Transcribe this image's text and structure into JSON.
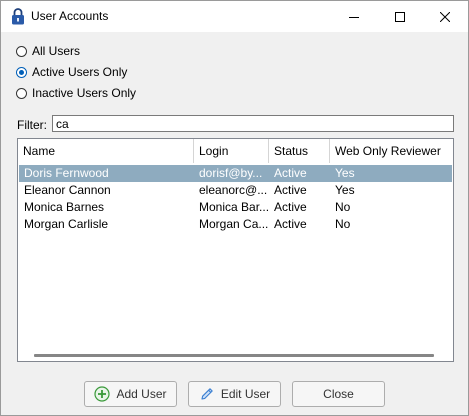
{
  "window": {
    "title": "User Accounts",
    "app_icon": "padlock-icon"
  },
  "filter_options": [
    {
      "label": "All Users",
      "checked": false
    },
    {
      "label": "Active Users Only",
      "checked": true
    },
    {
      "label": "Inactive Users Only",
      "checked": false
    }
  ],
  "filter": {
    "label": "Filter:",
    "value": "ca"
  },
  "table": {
    "columns": [
      "Name",
      "Login",
      "Status",
      "Web Only Reviewer"
    ],
    "rows": [
      {
        "name": "Doris Fernwood",
        "login": "dorisf@by...",
        "status": "Active",
        "web_only_reviewer": "Yes",
        "selected": true
      },
      {
        "name": "Eleanor Cannon",
        "login": "eleanorc@...",
        "status": "Active",
        "web_only_reviewer": "Yes",
        "selected": false
      },
      {
        "name": "Monica Barnes",
        "login": "Monica Bar...",
        "status": "Active",
        "web_only_reviewer": "No",
        "selected": false
      },
      {
        "name": "Morgan Carlisle",
        "login": "Morgan Ca...",
        "status": "Active",
        "web_only_reviewer": "No",
        "selected": false
      }
    ]
  },
  "buttons": {
    "add_user": "Add User",
    "edit_user": "Edit User",
    "close": "Close"
  },
  "colors": {
    "selected_row": "#8eabbf",
    "radio_accent": "#005fb8",
    "add_icon_green": "#3a9a3a",
    "edit_icon_blue": "#3b7fd1"
  }
}
